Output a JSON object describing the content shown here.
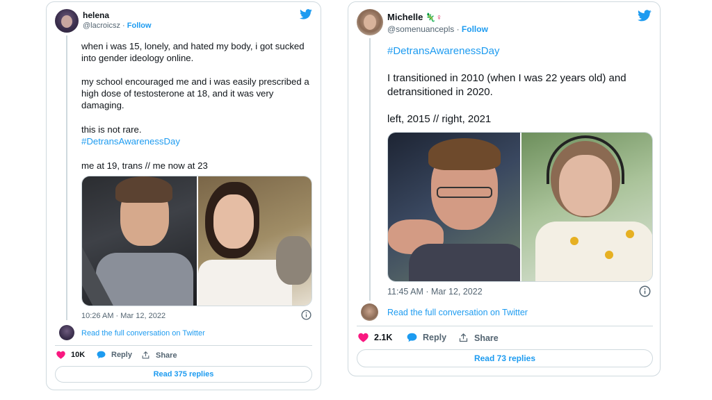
{
  "tweets": [
    {
      "display_name": "helena",
      "handle": "@lacroicsz",
      "follow_label": "Follow",
      "para1": "when i was 15, lonely, and hated my body, i got sucked into gender ideology online.",
      "para2": "my school encouraged me and i was easily prescribed a high dose of testosterone at 18, and it was very damaging.",
      "para3": "this is not rare.",
      "hashtag": "#DetransAwarenessDay",
      "caption": "me at 19, trans // me now at 23",
      "timestamp": "10:26 AM · Mar 12, 2022",
      "conversation_link": "Read the full conversation on Twitter",
      "likes": "10K",
      "reply_label": "Reply",
      "share_label": "Share",
      "read_replies": "Read 375 replies"
    },
    {
      "display_name": "Michelle",
      "name_emoji": "🦎♀",
      "handle": "@somenuancepls",
      "follow_label": "Follow",
      "hashtag": "#DetransAwarenessDay",
      "para1": "I transitioned in 2010 (when I was 22 years old) and detransitioned in 2020.",
      "caption": "left, 2015 // right, 2021",
      "timestamp": "11:45 AM · Mar 12, 2022",
      "conversation_link": "Read the full conversation on Twitter",
      "likes": "2.1K",
      "reply_label": "Reply",
      "share_label": "Share",
      "read_replies": "Read 73 replies"
    }
  ],
  "colors": {
    "accent": "#1d9bf0",
    "like": "#f91880",
    "muted": "#536471",
    "border": "#cfd9de"
  },
  "icons": [
    "twitter-bird-icon",
    "heart-icon",
    "reply-bubble-icon",
    "share-icon",
    "info-icon"
  ]
}
